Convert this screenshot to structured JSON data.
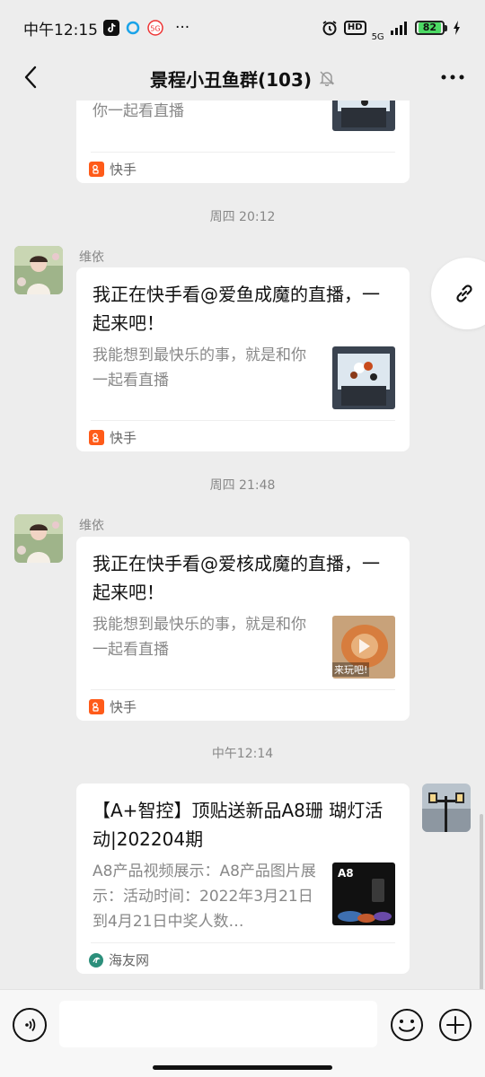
{
  "status_bar": {
    "time": "中午12:15",
    "more": "···",
    "network": "5G",
    "hd": "HD",
    "battery": "82"
  },
  "header": {
    "title": "景程小丑鱼群(103)"
  },
  "messages": [
    {
      "desc": "你一起看直播",
      "source": "快手"
    },
    {
      "time": "周四 20:12",
      "sender": "维依",
      "title": "我正在快手看@爱鱼成魔的直播，一起来吧！",
      "desc": "我能想到最快乐的事，就是和你一起看直播",
      "source": "快手"
    },
    {
      "time": "周四 21:48",
      "sender": "维依",
      "title": "我正在快手看@爱核成魔的直播，一起来吧！",
      "desc": "我能想到最快乐的事，就是和你一起看直播",
      "thumb_text": "来玩吧!",
      "source": "快手"
    },
    {
      "time": "中午12:14",
      "title": "【A+智控】顶贴送新品A8珊 瑚灯活动|202204期",
      "desc": "A8产品视频展示：A8产品图片展示：活动时间：2022年3月21日到4月21日中奖人数…",
      "thumb_text": "A8",
      "source": "海友网"
    }
  ],
  "input": {
    "placeholder": ""
  },
  "colors": {
    "background": "#ededed",
    "card": "#ffffff",
    "kuaishou": "#ff5b19",
    "haiyou": "#2c8f7b"
  },
  "icons": [
    "back-arrow-icon",
    "mute-bell-icon",
    "more-icon",
    "link-icon",
    "voice-icon",
    "emoji-icon",
    "plus-icon"
  ]
}
